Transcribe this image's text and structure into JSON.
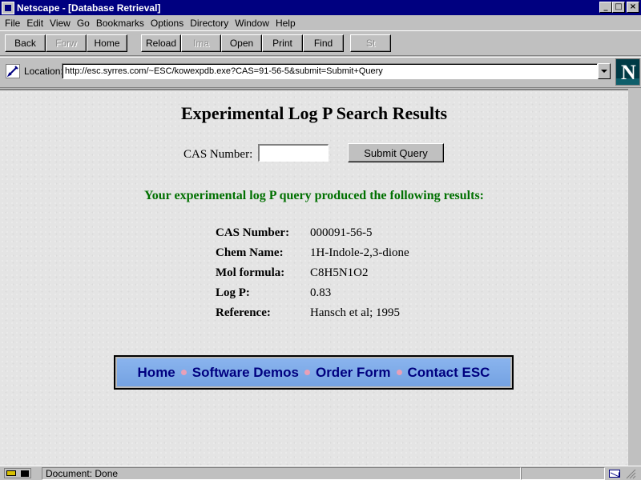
{
  "window": {
    "title": "Netscape - [Database Retrieval]"
  },
  "menu": [
    "File",
    "Edit",
    "View",
    "Go",
    "Bookmarks",
    "Options",
    "Directory",
    "Window",
    "Help"
  ],
  "toolbar": {
    "back": "Back",
    "forward": "Forw",
    "home": "Home",
    "reload": "Reload",
    "images": "Ima",
    "open": "Open",
    "print": "Print",
    "find": "Find",
    "stop": "St"
  },
  "location": {
    "label": "Location:",
    "url": "http://esc.syrres.com/~ESC/kowexpdb.exe?CAS=91-56-5&submit=Submit+Query"
  },
  "page": {
    "title": "Experimental Log P Search Results",
    "cas_label": "CAS Number:",
    "cas_value": "",
    "submit_label": "Submit Query",
    "result_message": "Your experimental log P query produced the following results:",
    "results": [
      {
        "label": "CAS Number:",
        "value": "000091-56-5"
      },
      {
        "label": "Chem Name:",
        "value": "1H-Indole-2,3-dione"
      },
      {
        "label": "Mol formula:",
        "value": "C8H5N1O2"
      },
      {
        "label": "Log P:",
        "value": "0.83"
      },
      {
        "label": "Reference:",
        "value": "Hansch et al; 1995"
      }
    ],
    "nav_links": [
      "Home",
      "Software Demos",
      "Order Form",
      "Contact ESC"
    ]
  },
  "status": {
    "text": "Document: Done"
  },
  "colors": {
    "titlebar": "#000080",
    "result_message": "#007000",
    "nav_text": "#000080",
    "nav_bg": "#80acec"
  }
}
